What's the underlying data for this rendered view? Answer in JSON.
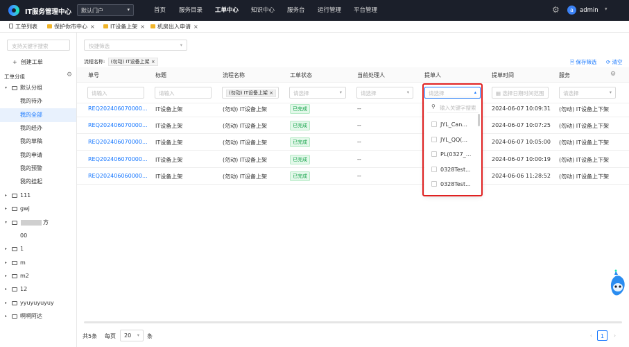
{
  "header": {
    "app_title": "IT服务管理中心",
    "portal_select": "默认门户",
    "nav": [
      "首页",
      "服务目录",
      "工单中心",
      "知识中心",
      "服务台",
      "运行管理",
      "平台管理"
    ],
    "active_nav": "工单中心",
    "user_initial": "a",
    "user_name": "admin"
  },
  "tabs": [
    {
      "label": "工单列表",
      "icon": "list-icon",
      "closable": false
    },
    {
      "label": "保护你市中心",
      "icon": "folder-icon",
      "closable": true
    },
    {
      "label": "IT设备上架",
      "icon": "folder-icon",
      "closable": true
    },
    {
      "label": "机房出入申请",
      "icon": "folder-icon",
      "closable": true
    }
  ],
  "sidebar": {
    "search_placeholder": "支持关键字搜索",
    "create_label": "创建工单",
    "group_title": "工单分组",
    "tree": [
      {
        "label": "默认分组",
        "level": 0,
        "expanded": true,
        "folder": true
      },
      {
        "label": "我的待办",
        "level": 1
      },
      {
        "label": "我的全部",
        "level": 1,
        "selected": true
      },
      {
        "label": "我的经办",
        "level": 1
      },
      {
        "label": "我的草稿",
        "level": 1
      },
      {
        "label": "我的申请",
        "level": 1
      },
      {
        "label": "我的预警",
        "level": 1
      },
      {
        "label": "我的挂起",
        "level": 1
      },
      {
        "label": "111",
        "level": 0,
        "expanded": false,
        "folder": true
      },
      {
        "label": "gwj",
        "level": 0,
        "expanded": false,
        "folder": true
      },
      {
        "label": "方",
        "level": 0,
        "expanded": true,
        "folder": true,
        "redacted": true
      },
      {
        "label": "00",
        "level": 1
      },
      {
        "label": "1",
        "level": 0,
        "expanded": false,
        "folder": true
      },
      {
        "label": "m",
        "level": 0,
        "expanded": false,
        "folder": true
      },
      {
        "label": "m2",
        "level": 0,
        "expanded": false,
        "folder": true
      },
      {
        "label": "12",
        "level": 0,
        "expanded": false,
        "folder": true
      },
      {
        "label": "yyuyuyuyuy",
        "level": 0,
        "expanded": false,
        "folder": true
      },
      {
        "label": "啊啊阿达",
        "level": 0,
        "expanded": false,
        "folder": true
      }
    ]
  },
  "toolbar": {
    "quick_filter_placeholder": "快捷筛选",
    "filter_label": "流程名称:",
    "filter_value": "(勿动) IT设备上架",
    "save_filter": "保存筛选",
    "clear": "清空"
  },
  "table": {
    "columns": [
      "单号",
      "标题",
      "流程名称",
      "工单状态",
      "当前处理人",
      "提单人",
      "提单时间",
      "服务"
    ],
    "filters": {
      "number_placeholder": "请输入",
      "title_placeholder": "请输入",
      "flow_tag": "(勿动) IT设备上架",
      "status_placeholder": "请选择",
      "handler_placeholder": "请选择",
      "submitter_placeholder": "请选择",
      "time_placeholder": "选择日期时间范围",
      "service_placeholder": "请选择"
    },
    "rows": [
      {
        "number": "REQ202406070000...",
        "title": "IT设备上架",
        "flow": "(勿动) IT设备上架",
        "status": "已完成",
        "handler": "--",
        "time": "2024-06-07 10:09:31",
        "service": "(勿动) IT设备上下架"
      },
      {
        "number": "REQ202406070000...",
        "title": "IT设备上架",
        "flow": "(勿动) IT设备上架",
        "status": "已完成",
        "handler": "--",
        "time": "2024-06-07 10:07:25",
        "service": "(勿动) IT设备上下架"
      },
      {
        "number": "REQ202406070000...",
        "title": "IT设备上架",
        "flow": "(勿动) IT设备上架",
        "status": "已完成",
        "handler": "--",
        "time": "2024-06-07 10:05:00",
        "service": "(勿动) IT设备上下架"
      },
      {
        "number": "REQ202406070000...",
        "title": "IT设备上架",
        "flow": "(勿动) IT设备上架",
        "status": "已完成",
        "handler": "--",
        "time": "2024-06-07 10:00:19",
        "service": "(勿动) IT设备上下架"
      },
      {
        "number": "REQ202406060000...",
        "title": "IT设备上架",
        "flow": "(勿动) IT设备上架",
        "status": "已完成",
        "handler": "--",
        "time": "2024-06-06 11:28:52",
        "service": "(勿动) IT设备上下架"
      }
    ]
  },
  "submitter_dropdown": {
    "search_placeholder": "输入关键字搜索",
    "options": [
      "JYL_Can...",
      "JYL_QQ(...",
      "PL(0327_...",
      "0328Test...",
      "0328Test..."
    ]
  },
  "pagination": {
    "total": "共5条",
    "per_page_label": "每页",
    "per_page": "20",
    "unit": "条",
    "current_page": "1"
  },
  "colors": {
    "topbar": "#1b1f2a",
    "accent": "#1677ff",
    "success": "#16a34a",
    "highlight": "#e02020"
  }
}
